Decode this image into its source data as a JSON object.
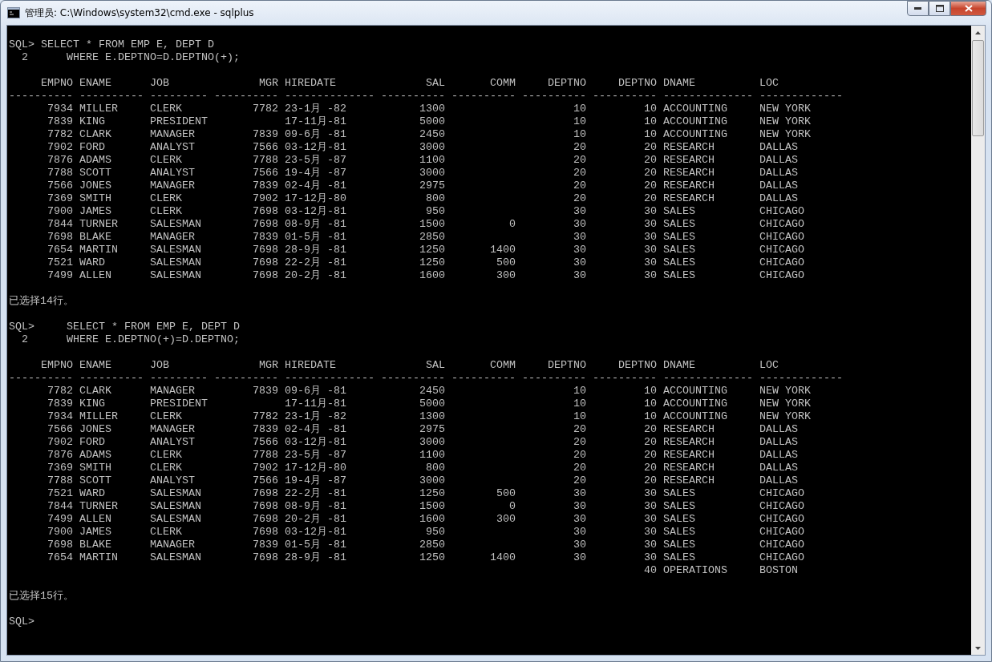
{
  "window": {
    "title": "管理员: C:\\Windows\\system32\\cmd.exe - sqlplus"
  },
  "console": {
    "blocks": [
      {
        "kind": "blank"
      },
      {
        "kind": "text",
        "text": "SQL> SELECT * FROM EMP E, DEPT D"
      },
      {
        "kind": "text",
        "text": "  2      WHERE E.DEPTNO=D.DEPTNO(+);"
      },
      {
        "kind": "blank"
      },
      {
        "kind": "table",
        "columns": [
          "EMPNO",
          "ENAME",
          "JOB",
          "MGR",
          "HIREDATE",
          "SAL",
          "COMM",
          "DEPTNO",
          "DEPTNO",
          "DNAME",
          "LOC"
        ],
        "rules": [
          "----------",
          "----------",
          "---------",
          "----------",
          "--------------",
          "----------",
          "----------",
          "----------",
          "----------",
          "--------------",
          "-------------"
        ],
        "rows": [
          [
            "7934",
            "MILLER",
            "CLERK",
            "7782",
            "23-1月 -82",
            "1300",
            null,
            "10",
            "10",
            "ACCOUNTING",
            "NEW YORK"
          ],
          [
            "7839",
            "KING",
            "PRESIDENT",
            null,
            "17-11月-81",
            "5000",
            null,
            "10",
            "10",
            "ACCOUNTING",
            "NEW YORK"
          ],
          [
            "7782",
            "CLARK",
            "MANAGER",
            "7839",
            "09-6月 -81",
            "2450",
            null,
            "10",
            "10",
            "ACCOUNTING",
            "NEW YORK"
          ],
          [
            "7902",
            "FORD",
            "ANALYST",
            "7566",
            "03-12月-81",
            "3000",
            null,
            "20",
            "20",
            "RESEARCH",
            "DALLAS"
          ],
          [
            "7876",
            "ADAMS",
            "CLERK",
            "7788",
            "23-5月 -87",
            "1100",
            null,
            "20",
            "20",
            "RESEARCH",
            "DALLAS"
          ],
          [
            "7788",
            "SCOTT",
            "ANALYST",
            "7566",
            "19-4月 -87",
            "3000",
            null,
            "20",
            "20",
            "RESEARCH",
            "DALLAS"
          ],
          [
            "7566",
            "JONES",
            "MANAGER",
            "7839",
            "02-4月 -81",
            "2975",
            null,
            "20",
            "20",
            "RESEARCH",
            "DALLAS"
          ],
          [
            "7369",
            "SMITH",
            "CLERK",
            "7902",
            "17-12月-80",
            "800",
            null,
            "20",
            "20",
            "RESEARCH",
            "DALLAS"
          ],
          [
            "7900",
            "JAMES",
            "CLERK",
            "7698",
            "03-12月-81",
            "950",
            null,
            "30",
            "30",
            "SALES",
            "CHICAGO"
          ],
          [
            "7844",
            "TURNER",
            "SALESMAN",
            "7698",
            "08-9月 -81",
            "1500",
            "0",
            "30",
            "30",
            "SALES",
            "CHICAGO"
          ],
          [
            "7698",
            "BLAKE",
            "MANAGER",
            "7839",
            "01-5月 -81",
            "2850",
            null,
            "30",
            "30",
            "SALES",
            "CHICAGO"
          ],
          [
            "7654",
            "MARTIN",
            "SALESMAN",
            "7698",
            "28-9月 -81",
            "1250",
            "1400",
            "30",
            "30",
            "SALES",
            "CHICAGO"
          ],
          [
            "7521",
            "WARD",
            "SALESMAN",
            "7698",
            "22-2月 -81",
            "1250",
            "500",
            "30",
            "30",
            "SALES",
            "CHICAGO"
          ],
          [
            "7499",
            "ALLEN",
            "SALESMAN",
            "7698",
            "20-2月 -81",
            "1600",
            "300",
            "30",
            "30",
            "SALES",
            "CHICAGO"
          ]
        ]
      },
      {
        "kind": "blank"
      },
      {
        "kind": "text",
        "text": "已选择14行。"
      },
      {
        "kind": "blank"
      },
      {
        "kind": "text",
        "text": "SQL>     SELECT * FROM EMP E, DEPT D"
      },
      {
        "kind": "text",
        "text": "  2      WHERE E.DEPTNO(+)=D.DEPTNO;"
      },
      {
        "kind": "blank"
      },
      {
        "kind": "table",
        "columns": [
          "EMPNO",
          "ENAME",
          "JOB",
          "MGR",
          "HIREDATE",
          "SAL",
          "COMM",
          "DEPTNO",
          "DEPTNO",
          "DNAME",
          "LOC"
        ],
        "rules": [
          "----------",
          "----------",
          "---------",
          "----------",
          "--------------",
          "----------",
          "----------",
          "----------",
          "----------",
          "--------------",
          "-------------"
        ],
        "rows": [
          [
            "7782",
            "CLARK",
            "MANAGER",
            "7839",
            "09-6月 -81",
            "2450",
            null,
            "10",
            "10",
            "ACCOUNTING",
            "NEW YORK"
          ],
          [
            "7839",
            "KING",
            "PRESIDENT",
            null,
            "17-11月-81",
            "5000",
            null,
            "10",
            "10",
            "ACCOUNTING",
            "NEW YORK"
          ],
          [
            "7934",
            "MILLER",
            "CLERK",
            "7782",
            "23-1月 -82",
            "1300",
            null,
            "10",
            "10",
            "ACCOUNTING",
            "NEW YORK"
          ],
          [
            "7566",
            "JONES",
            "MANAGER",
            "7839",
            "02-4月 -81",
            "2975",
            null,
            "20",
            "20",
            "RESEARCH",
            "DALLAS"
          ],
          [
            "7902",
            "FORD",
            "ANALYST",
            "7566",
            "03-12月-81",
            "3000",
            null,
            "20",
            "20",
            "RESEARCH",
            "DALLAS"
          ],
          [
            "7876",
            "ADAMS",
            "CLERK",
            "7788",
            "23-5月 -87",
            "1100",
            null,
            "20",
            "20",
            "RESEARCH",
            "DALLAS"
          ],
          [
            "7369",
            "SMITH",
            "CLERK",
            "7902",
            "17-12月-80",
            "800",
            null,
            "20",
            "20",
            "RESEARCH",
            "DALLAS"
          ],
          [
            "7788",
            "SCOTT",
            "ANALYST",
            "7566",
            "19-4月 -87",
            "3000",
            null,
            "20",
            "20",
            "RESEARCH",
            "DALLAS"
          ],
          [
            "7521",
            "WARD",
            "SALESMAN",
            "7698",
            "22-2月 -81",
            "1250",
            "500",
            "30",
            "30",
            "SALES",
            "CHICAGO"
          ],
          [
            "7844",
            "TURNER",
            "SALESMAN",
            "7698",
            "08-9月 -81",
            "1500",
            "0",
            "30",
            "30",
            "SALES",
            "CHICAGO"
          ],
          [
            "7499",
            "ALLEN",
            "SALESMAN",
            "7698",
            "20-2月 -81",
            "1600",
            "300",
            "30",
            "30",
            "SALES",
            "CHICAGO"
          ],
          [
            "7900",
            "JAMES",
            "CLERK",
            "7698",
            "03-12月-81",
            "950",
            null,
            "30",
            "30",
            "SALES",
            "CHICAGO"
          ],
          [
            "7698",
            "BLAKE",
            "MANAGER",
            "7839",
            "01-5月 -81",
            "2850",
            null,
            "30",
            "30",
            "SALES",
            "CHICAGO"
          ],
          [
            "7654",
            "MARTIN",
            "SALESMAN",
            "7698",
            "28-9月 -81",
            "1250",
            "1400",
            "30",
            "30",
            "SALES",
            "CHICAGO"
          ],
          [
            null,
            null,
            null,
            null,
            null,
            null,
            null,
            null,
            "40",
            "OPERATIONS",
            "BOSTON"
          ]
        ]
      },
      {
        "kind": "blank"
      },
      {
        "kind": "text",
        "text": "已选择15行。"
      },
      {
        "kind": "blank"
      },
      {
        "kind": "text",
        "text": "SQL>"
      }
    ]
  }
}
